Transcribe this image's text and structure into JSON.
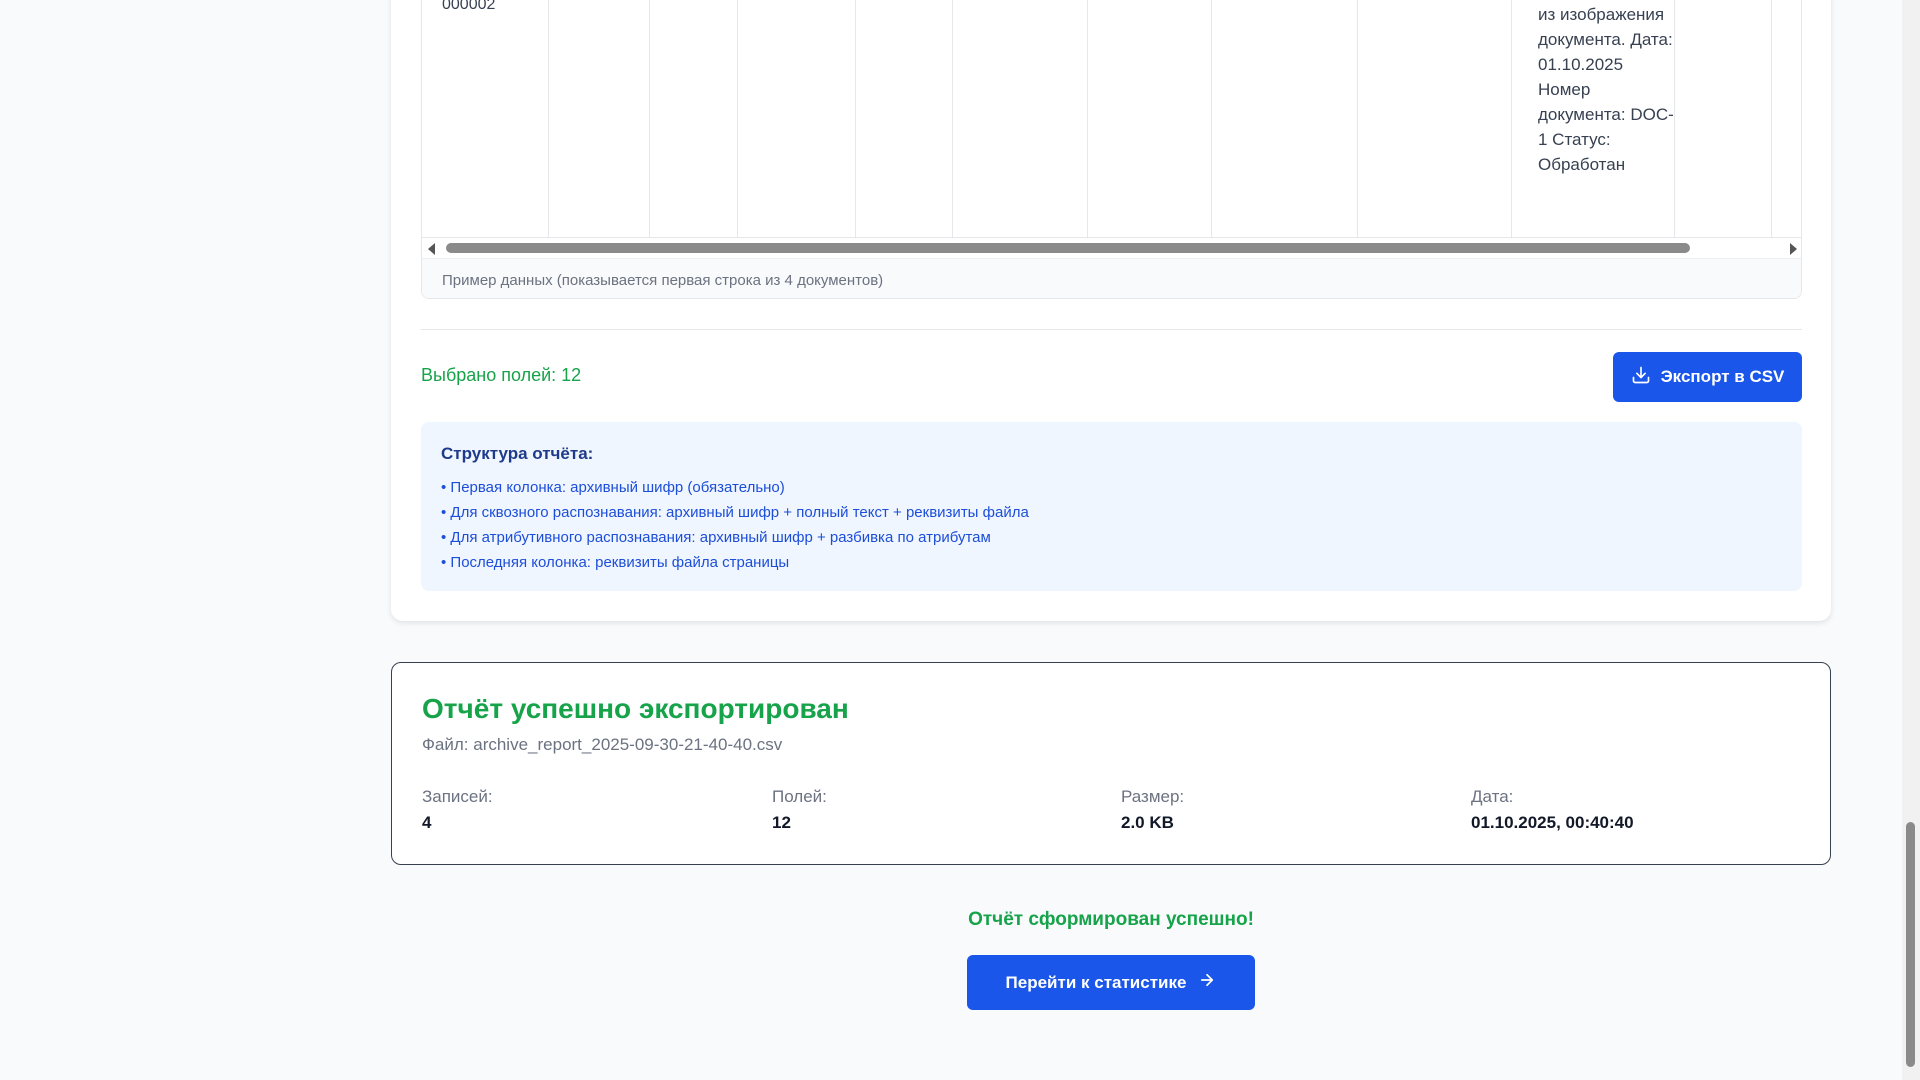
{
  "table": {
    "row_code": "000002",
    "row_text": "из изображения документа. Дата: 01.10.2025 Номер документа: DOC-1 Статус: Обработан",
    "caption": "Пример данных (показывается первая строка из 4 документов)"
  },
  "selection": {
    "count_text": "Выбрано полей: 12",
    "export_label": "Экспорт в CSV"
  },
  "structure": {
    "title": "Структура отчёта:",
    "items": [
      "• Первая колонка: архивный шифр (обязательно)",
      "• Для сквозного распознавания: архивный шифр + полный текст + реквизиты файла",
      "• Для атрибутивного распознавания: архивный шифр + разбивка по атрибутам",
      "• Последняя колонка: реквизиты файла страницы"
    ]
  },
  "export_result": {
    "title": "Отчёт успешно экспортирован",
    "file": "Файл: archive_report_2025-09-30-21-40-40.csv",
    "stats": [
      {
        "label": "Записей:",
        "value": "4"
      },
      {
        "label": "Полей:",
        "value": "12"
      },
      {
        "label": "Размер:",
        "value": "2.0 KB"
      },
      {
        "label": "Дата:",
        "value": "01.10.2025, 00:40:40"
      }
    ]
  },
  "footer": {
    "message": "Отчёт сформирован успешно!",
    "stats_button": "Перейти к статистике"
  },
  "colors": {
    "accent_blue": "#1a56ea",
    "success_green": "#16a34a",
    "info_bg": "#eff6ff"
  },
  "icons": [
    "download-icon",
    "arrow-right-icon"
  ]
}
